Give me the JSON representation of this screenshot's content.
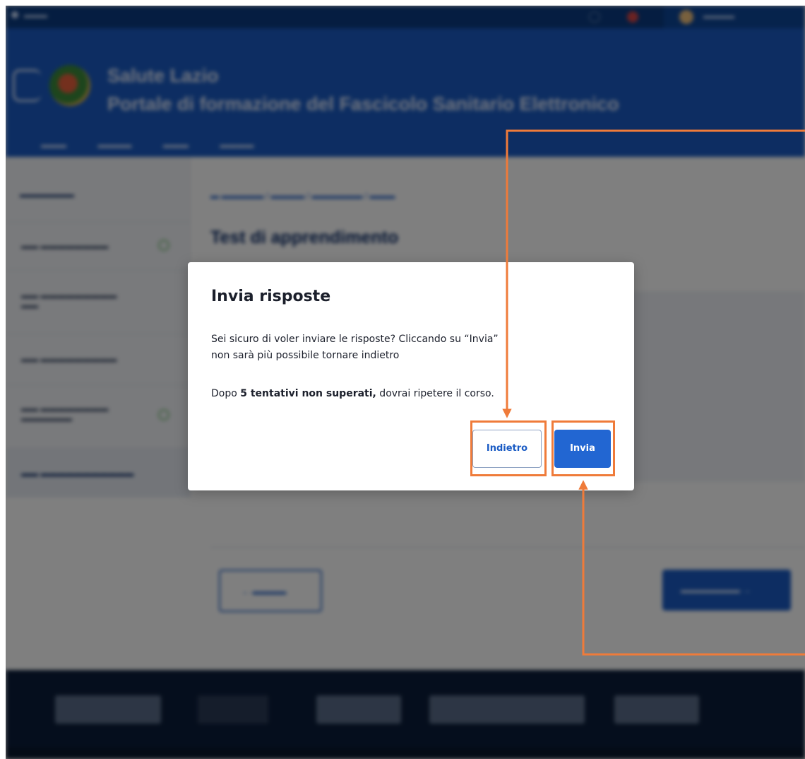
{
  "modal": {
    "title": "Invia risposte",
    "message_line1": "Sei sicuro di voler inviare le risposte? Cliccando su “Invia”",
    "message_line2": "non sarà più possibile tornare indietro",
    "note_prefix": "Dopo ",
    "note_bold": "5 tentativi non superati,",
    "note_suffix": " dovrai ripetere il corso.",
    "back_label": "Indietro",
    "send_label": "Invia"
  },
  "background": {
    "header": {
      "title_line1": "Salute Lazio",
      "title_line2": "Portale di formazione del Fascicolo Sanitario Elettronico"
    },
    "page_title": "Test di apprendimento"
  },
  "colors": {
    "header_blue": "#1a5bc4",
    "primary_button": "#2266d2",
    "annotation_orange": "#ef7b3a",
    "footer_navy": "#0b1d3a"
  }
}
